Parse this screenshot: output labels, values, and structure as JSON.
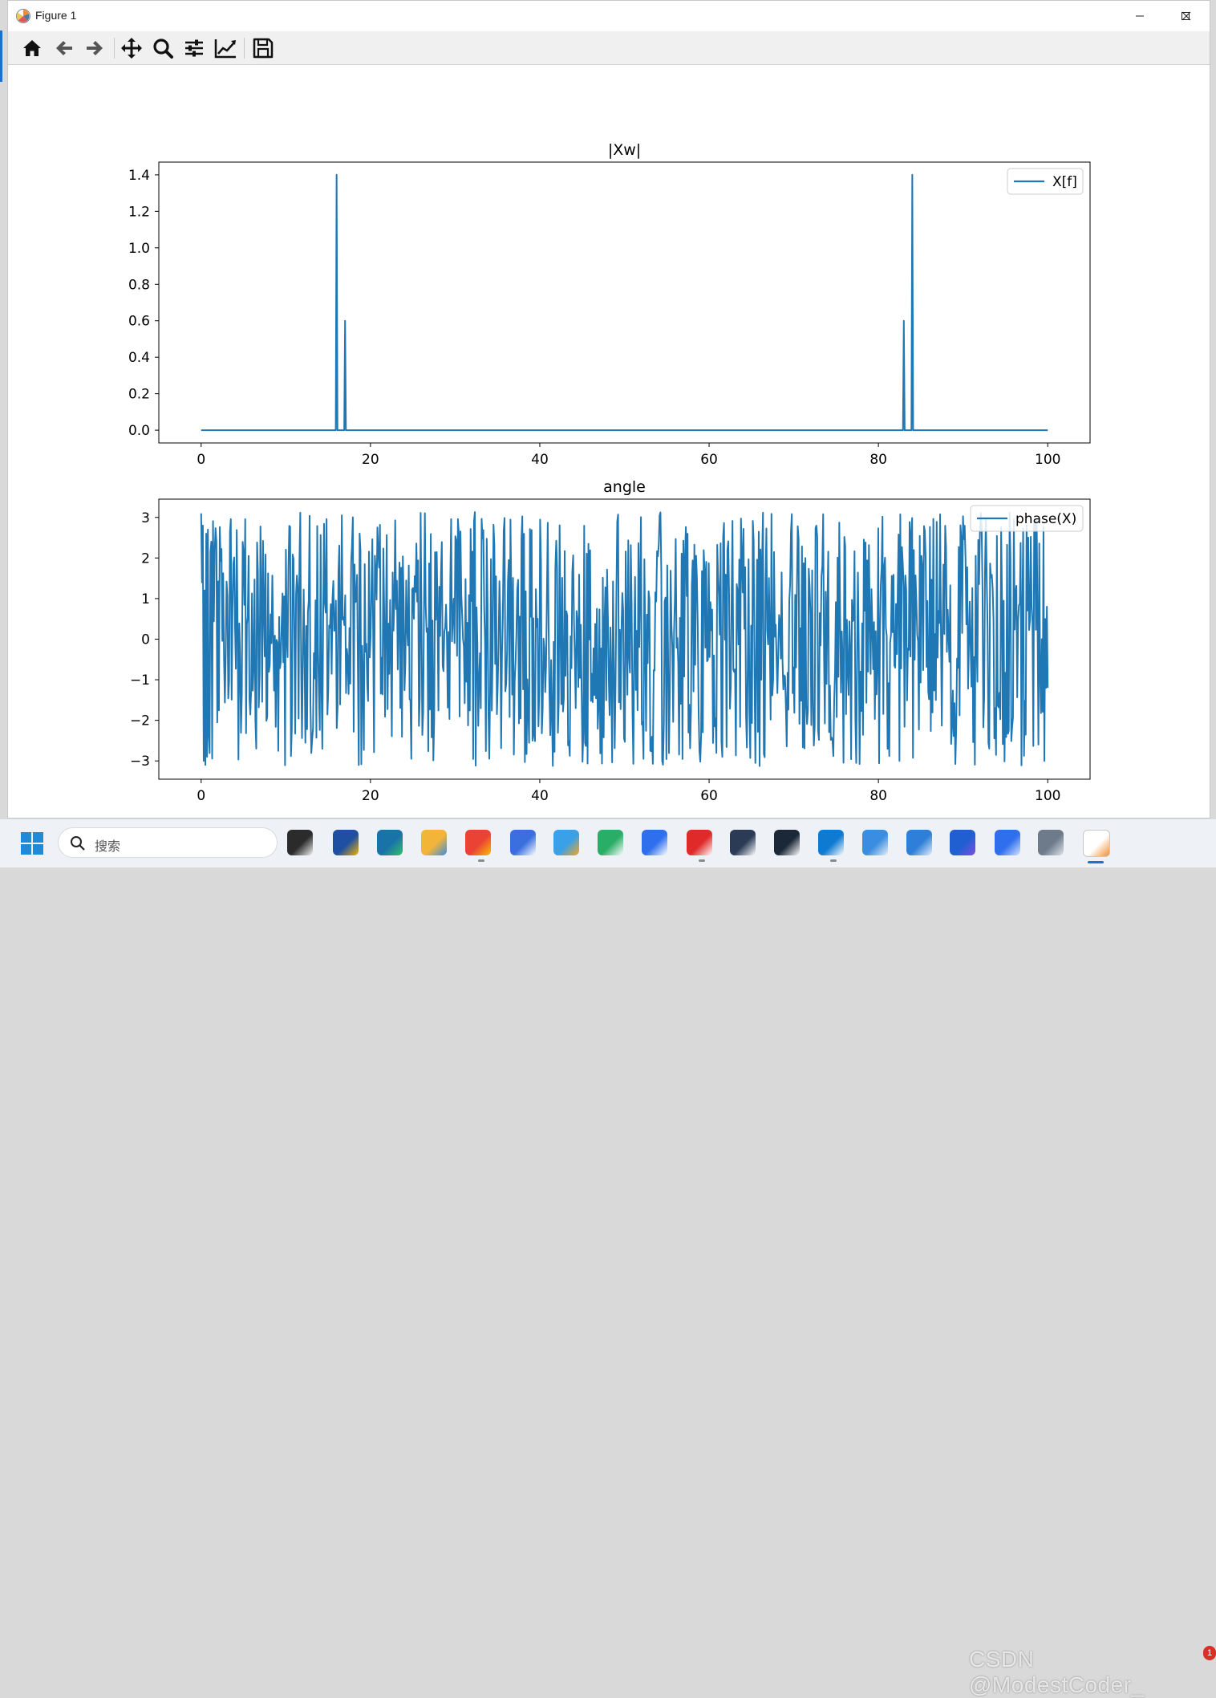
{
  "window": {
    "title": "Figure 1",
    "icon": "matplotlib-icon"
  },
  "toolbar": {
    "buttons": [
      "home-icon",
      "back-arrow-icon",
      "forward-arrow-icon",
      "pan-icon",
      "zoom-icon",
      "subplots-icon",
      "edit-axes-icon",
      "save-icon"
    ]
  },
  "taskbar": {
    "search_placeholder": "搜索",
    "apps": [
      "task-view",
      "microsoft-store",
      "edge-dev",
      "file-explorer",
      "chrome",
      "baidu-netdisk",
      "paint",
      "wechat",
      "feishu",
      "netease-music",
      "cat-app",
      "steam",
      "vscode",
      "control-panel",
      "notepad",
      "copilot",
      "app-blue",
      "app-gray",
      "matplotlib-figure"
    ],
    "watermark": "CSDN @ModestCoder_",
    "notification_count": "1"
  },
  "colors": {
    "series": "#1f77b4",
    "accent": "#1f6fd1"
  },
  "chart_data": [
    {
      "type": "line",
      "title": "|Xw|",
      "xlabel": "",
      "ylabel": "",
      "xlim": [
        -5,
        105
      ],
      "ylim": [
        -0.07,
        1.47
      ],
      "xticks": [
        0,
        20,
        40,
        60,
        80,
        100
      ],
      "xtick_labels": [
        "0",
        "20",
        "40",
        "60",
        "80",
        "100"
      ],
      "yticks": [
        0.0,
        0.2,
        0.4,
        0.6,
        0.8,
        1.0,
        1.2,
        1.4
      ],
      "ytick_labels": [
        "0.0",
        "0.2",
        "0.4",
        "0.6",
        "0.8",
        "1.0",
        "1.2",
        "1.4"
      ],
      "legend": "upper right",
      "grid": false,
      "series": [
        {
          "name": "X[f]",
          "x": [
            0,
            15.9,
            16,
            16.1,
            16.9,
            17,
            17.1,
            82.9,
            83,
            83.1,
            83.9,
            84,
            84.1,
            100
          ],
          "y": [
            0,
            0,
            1.4,
            0,
            0,
            0.6,
            0,
            0,
            0.6,
            0,
            0,
            1.4,
            0,
            0
          ]
        }
      ]
    },
    {
      "type": "line",
      "title": "angle",
      "xlabel": "",
      "ylabel": "",
      "xlim": [
        -5,
        105
      ],
      "ylim": [
        -3.45,
        3.45
      ],
      "xticks": [
        0,
        20,
        40,
        60,
        80,
        100
      ],
      "xtick_labels": [
        "0",
        "20",
        "40",
        "60",
        "80",
        "100"
      ],
      "yticks": [
        3,
        2,
        1,
        0,
        -1,
        -2,
        -3
      ],
      "ytick_labels": [
        "3",
        "2",
        "1",
        "0",
        "−1",
        "−2",
        "−3"
      ],
      "legend": "upper right",
      "grid": false,
      "series": [
        {
          "name": "phase(X)",
          "x_range": [
            0,
            100
          ],
          "points": 1000,
          "y_range": [
            -3.14159,
            3.14159
          ],
          "first_values": [
            3.1,
            1.4,
            2.8,
            -3.0,
            1.2,
            -3.1,
            2.6,
            -2.9,
            2.7,
            -2.4
          ],
          "last_values": [
            -3.0,
            0.5,
            -1.2,
            0.8,
            -1.2
          ]
        }
      ]
    }
  ]
}
